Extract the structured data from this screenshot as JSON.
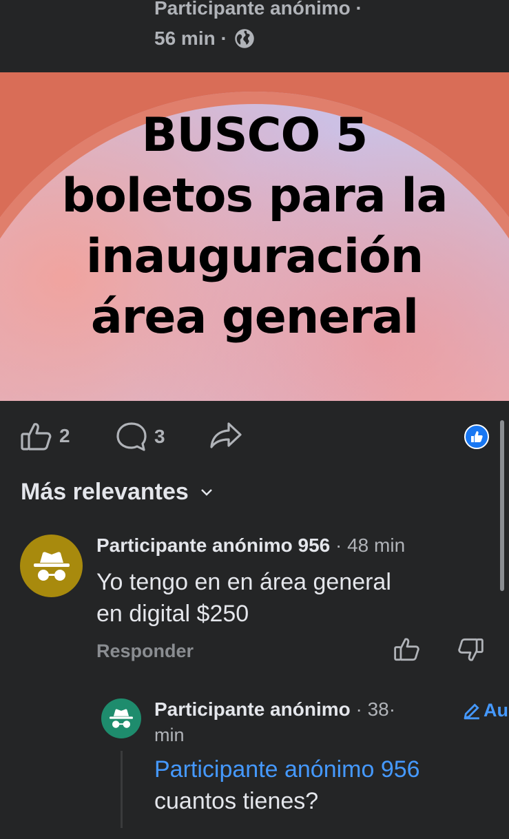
{
  "post": {
    "author": "Participante anónimo ·",
    "time": "56 min ·",
    "privacy_icon": "globe-icon",
    "image_text": [
      "BUSCO 5",
      "boletos para la",
      "inauguración",
      "área general"
    ]
  },
  "actions": {
    "likes": "2",
    "comments": "3",
    "like_icon": "thumbs-up-icon",
    "comment_icon": "comment-bubble-icon",
    "share_icon": "share-arrow-icon",
    "reaction_icon": "like-reaction-icon",
    "reaction_color": "#1877f2"
  },
  "sort": {
    "label": "Más relevantes"
  },
  "comments": [
    {
      "author": "Participante anónimo 956",
      "time": "· 48 min",
      "text_line1": "Yo tengo en en área general",
      "text_line2": "en digital $250",
      "reply_label": "Responder",
      "avatar_color": "#a88a0d"
    },
    {
      "author": "Participante anónimo",
      "time": "· 38·",
      "time2": "min",
      "author_tag": "Au",
      "mention": "Participante anónimo 956",
      "text": "cuantos tienes?",
      "avatar_color": "#1e8c6d"
    }
  ]
}
